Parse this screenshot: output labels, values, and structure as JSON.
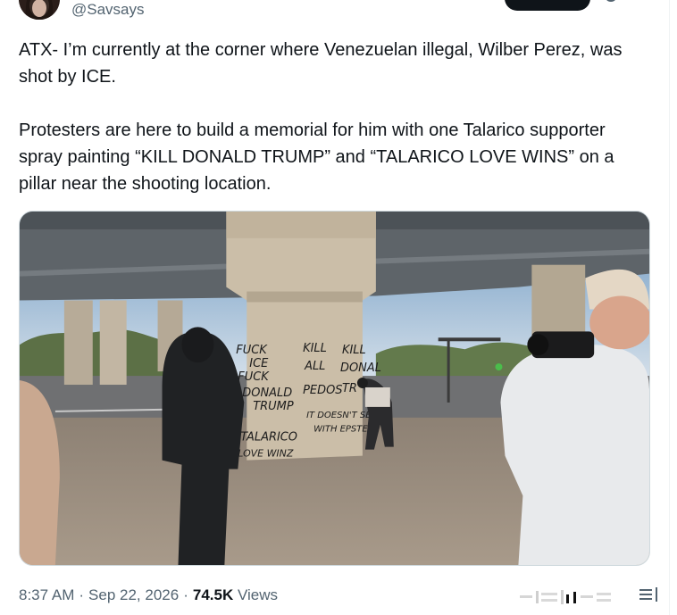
{
  "author": {
    "handle": "@Savsays"
  },
  "tweet": {
    "text": "ATX- I’m currently at the corner where Venezuelan illegal, Wilber Perez, was shot by ICE.\n\nProtesters are here to build a memorial for him with one Talarico supporter spray painting “KILL DONALD TRUMP” and “TALARICO LOVE WINS” on a pillar near the shooting location."
  },
  "media": {
    "graffiti": [
      "FUCK",
      "ICE",
      "FUCK",
      "DONALD",
      "TRUMP",
      "TALARICO",
      "LOVE WINZ",
      "KILL",
      "ALL",
      "PEDOS",
      "KILL",
      "DONAL",
      "TR",
      "IT DOESN'T SEE",
      "WITH EPSTEIN"
    ]
  },
  "meta": {
    "time": "8:37 AM",
    "separator": "·",
    "date": "Sep 22, 2026",
    "views_count": "74.5K",
    "views_label": "Views"
  },
  "icons": {
    "more": "more-icon",
    "analytics": "analytics-icon"
  },
  "colors": {
    "text": "#0f1419",
    "secondary": "#536471",
    "border": "#cfd9de",
    "button": "#0f1419"
  }
}
